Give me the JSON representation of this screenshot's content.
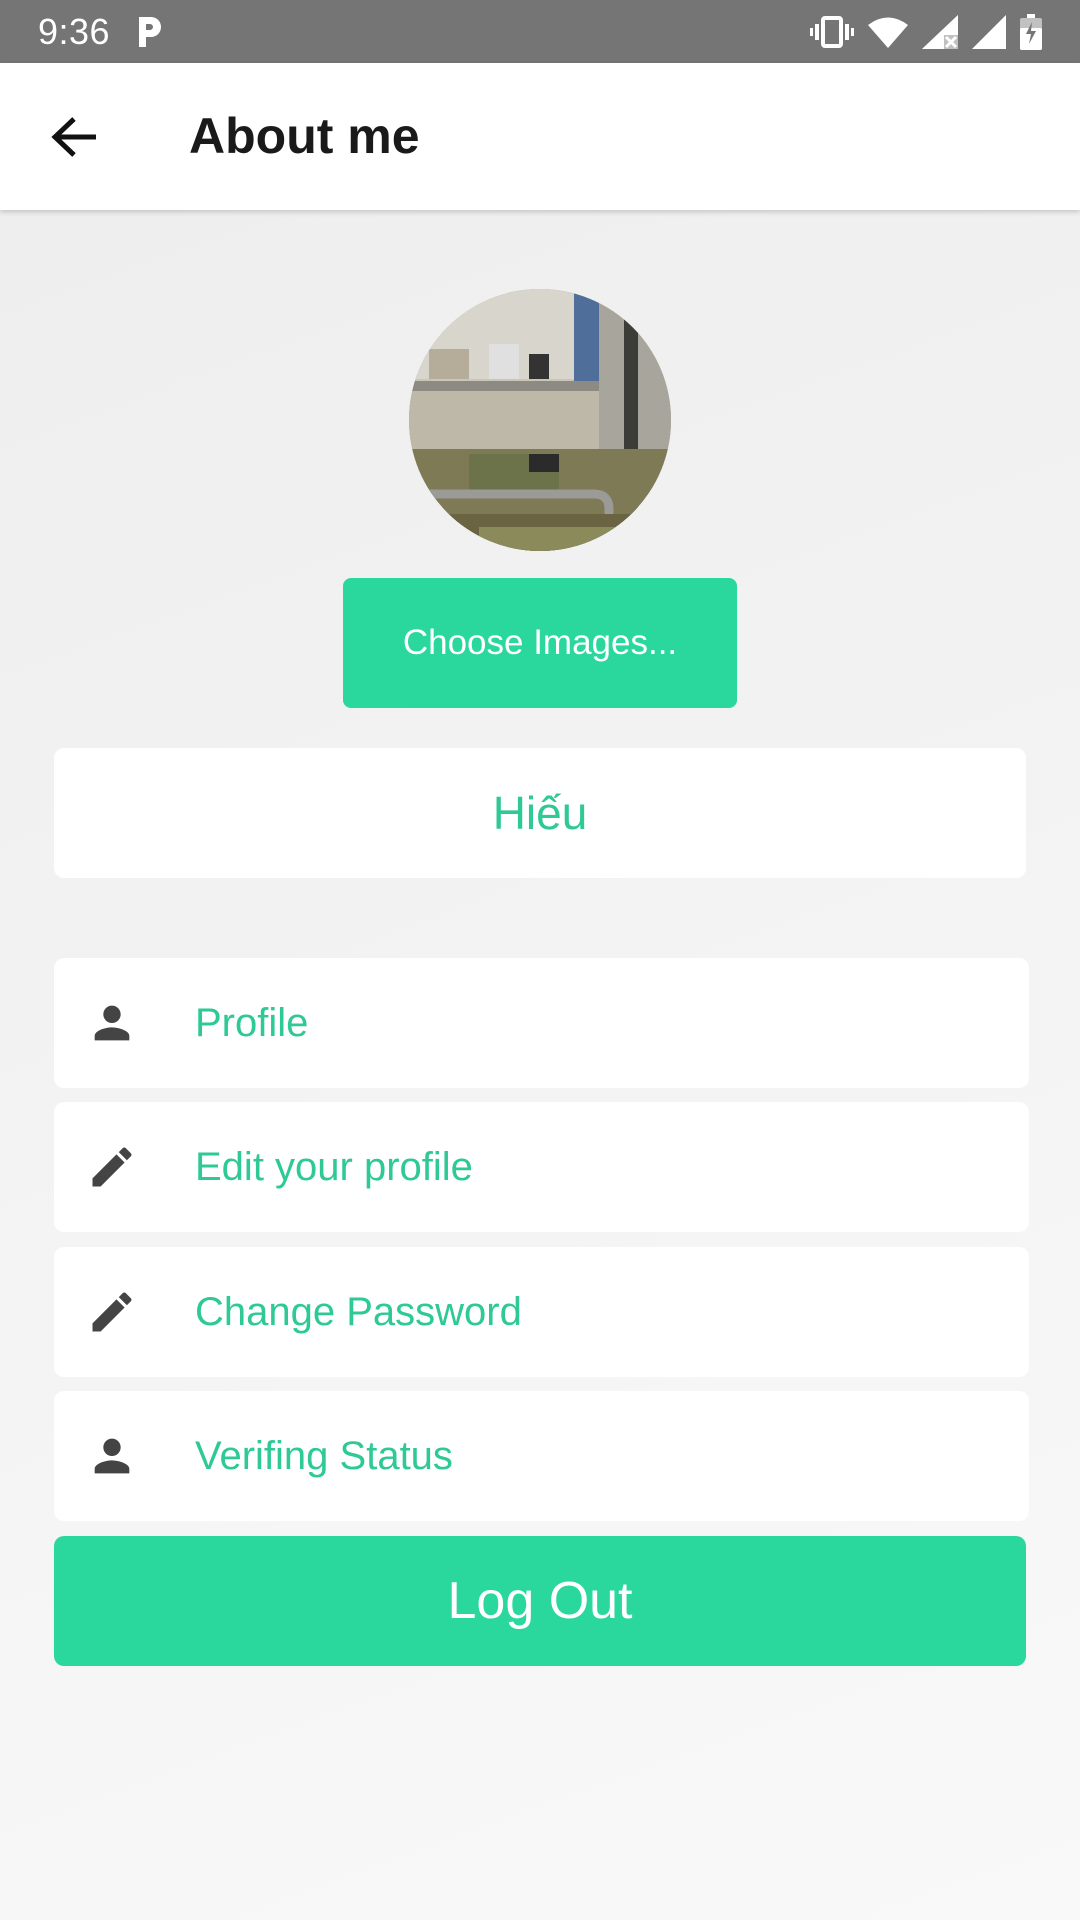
{
  "status_bar": {
    "time": "9:36",
    "notification_icon": "p-icon",
    "icons": [
      "vibrate-icon",
      "wifi-icon",
      "signal-x-icon",
      "signal-icon",
      "battery-icon"
    ]
  },
  "app_bar": {
    "back_icon": "arrow-left-icon",
    "title": "About me"
  },
  "avatar": {
    "alt": "avatar-photo"
  },
  "choose_images_label": "Choose Images...",
  "user_name": "Hiếu",
  "menu": [
    {
      "label": "Profile",
      "icon": "person-icon"
    },
    {
      "label": "Edit your profile",
      "icon": "pencil-icon"
    },
    {
      "label": "Change Password",
      "icon": "pencil-icon"
    },
    {
      "label": "Verifing Status",
      "icon": "person-icon"
    }
  ],
  "logout_label": "Log Out",
  "colors": {
    "accent": "#2ad89e",
    "accent_text": "#2ec995",
    "status_bar": "#757575",
    "icon": "#444444"
  }
}
